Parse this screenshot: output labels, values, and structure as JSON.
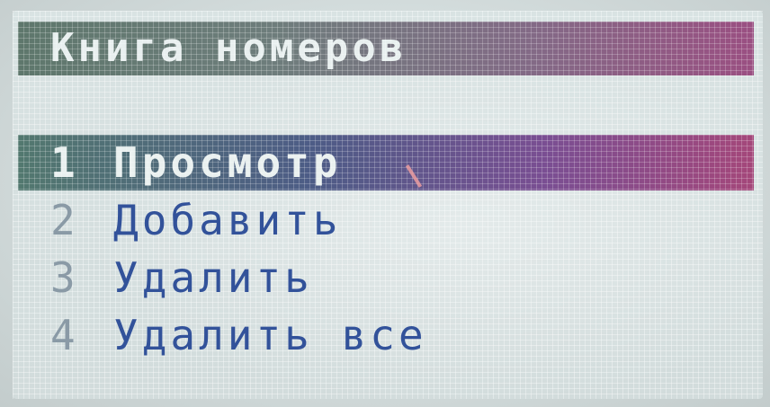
{
  "screen": {
    "title": "Книга номеров",
    "menu": [
      {
        "number": "1",
        "label": "Просмотр"
      },
      {
        "number": "2",
        "label": "Добавить"
      },
      {
        "number": "3",
        "label": "Удалить"
      },
      {
        "number": "4",
        "label": "Удалить все"
      }
    ],
    "selected_index": 0
  },
  "colors": {
    "header_start": "#5e776c",
    "header_end": "#9a4f82",
    "selection_start": "#52786f",
    "selection_end": "#a4477a",
    "menu_text": "#32529a",
    "lcd_background": "#d9e3e3"
  }
}
